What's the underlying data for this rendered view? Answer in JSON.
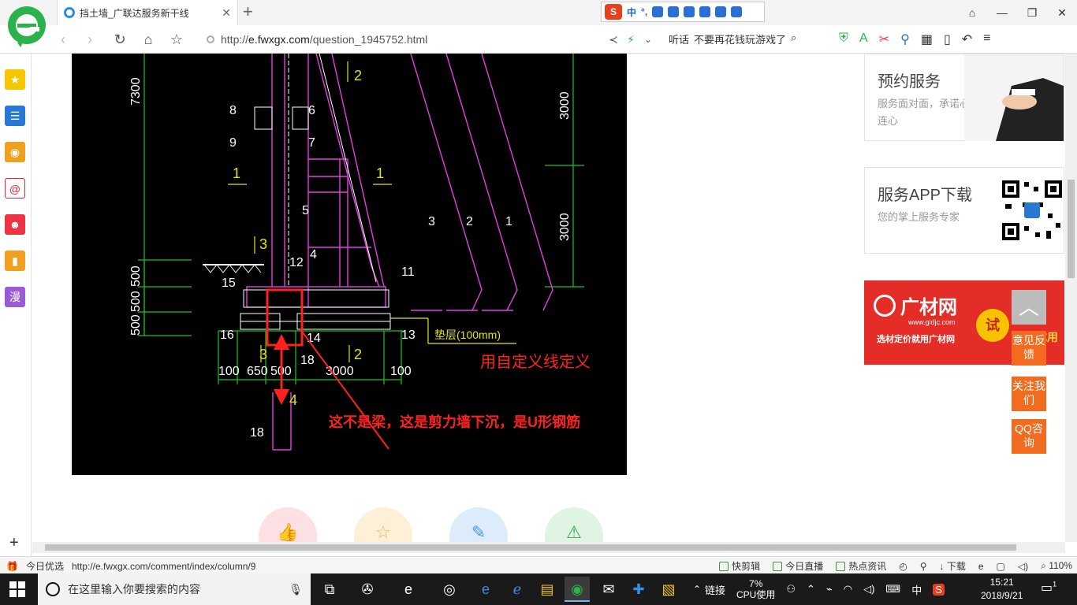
{
  "browser": {
    "tab_title": "挡土墙_广联达服务新干线",
    "new_tab": "+",
    "close": "✕",
    "url_prefix": "http://",
    "url_host": "e.fwxgx.com",
    "url_path": "/question_1945752.html",
    "search_hint_label": "听话",
    "search_hint": "不要再花钱玩游戏了",
    "window_controls": [
      "⌂",
      "—",
      "❐",
      "✕"
    ]
  },
  "ime": {
    "logo": "S",
    "mode": "中",
    "punct": "°,"
  },
  "cad": {
    "dim_left_top": "7300",
    "dim_right_top": "3000",
    "dim_right_mid": "3000",
    "dim_left_group": [
      "500",
      "500",
      "500"
    ],
    "labels_white": [
      "8",
      "6",
      "9",
      "7",
      "5",
      "4",
      "12",
      "11",
      "15",
      "16",
      "14",
      "13",
      "18",
      "18",
      "3",
      "2",
      "1"
    ],
    "labels_yellow": [
      "2",
      "1",
      "1",
      "3",
      "3",
      "2",
      "4"
    ],
    "cushion_label": "垫层(100mm)",
    "dims_bottom": [
      "100",
      "650",
      "500",
      "3000",
      "100"
    ],
    "note_custom_line": "用自定义线定义",
    "note_not_beam": "这不是梁，这是剪力墙下沉，是U形钢筋"
  },
  "right_panel": {
    "booking": {
      "title": "预约服务",
      "desc": "服务面对面，承诺心连心"
    },
    "app": {
      "title": "服务APP下载",
      "desc": "您的掌上服务专家"
    },
    "ad": {
      "name": "广材网",
      "url": "www.gldjc.com",
      "slogan": "选材定价就用广材网",
      "try": "试",
      "right": "P",
      "right2": "优惠试用"
    }
  },
  "float": {
    "to_top": "︿",
    "feedback": "意见反馈",
    "follow": "关注我们",
    "qq": "QQ咨询"
  },
  "actions": [
    "👍",
    "☆",
    "✎",
    "⚠"
  ],
  "status": {
    "today_pick": "今日优选",
    "hover_url": "http://e.fwxgx.com/comment/index/column/9",
    "items": [
      "快剪辑",
      "今日直播",
      "热点资讯",
      "下载",
      "110%"
    ]
  },
  "taskbar": {
    "search_placeholder": "在这里输入你要搜索的内容",
    "tray_link": "链接",
    "cpu_pct": "7%",
    "cpu_label": "CPU使用",
    "ime": "中",
    "time": "15:21",
    "date": "2018/9/21",
    "notif_count": "1"
  },
  "colors": {
    "accent_orange": "#f26b1f",
    "cad_magenta": "#e040e0",
    "cad_green": "#1fc11f",
    "cad_yellow": "#e6e600",
    "annot_red": "#ff2020"
  }
}
